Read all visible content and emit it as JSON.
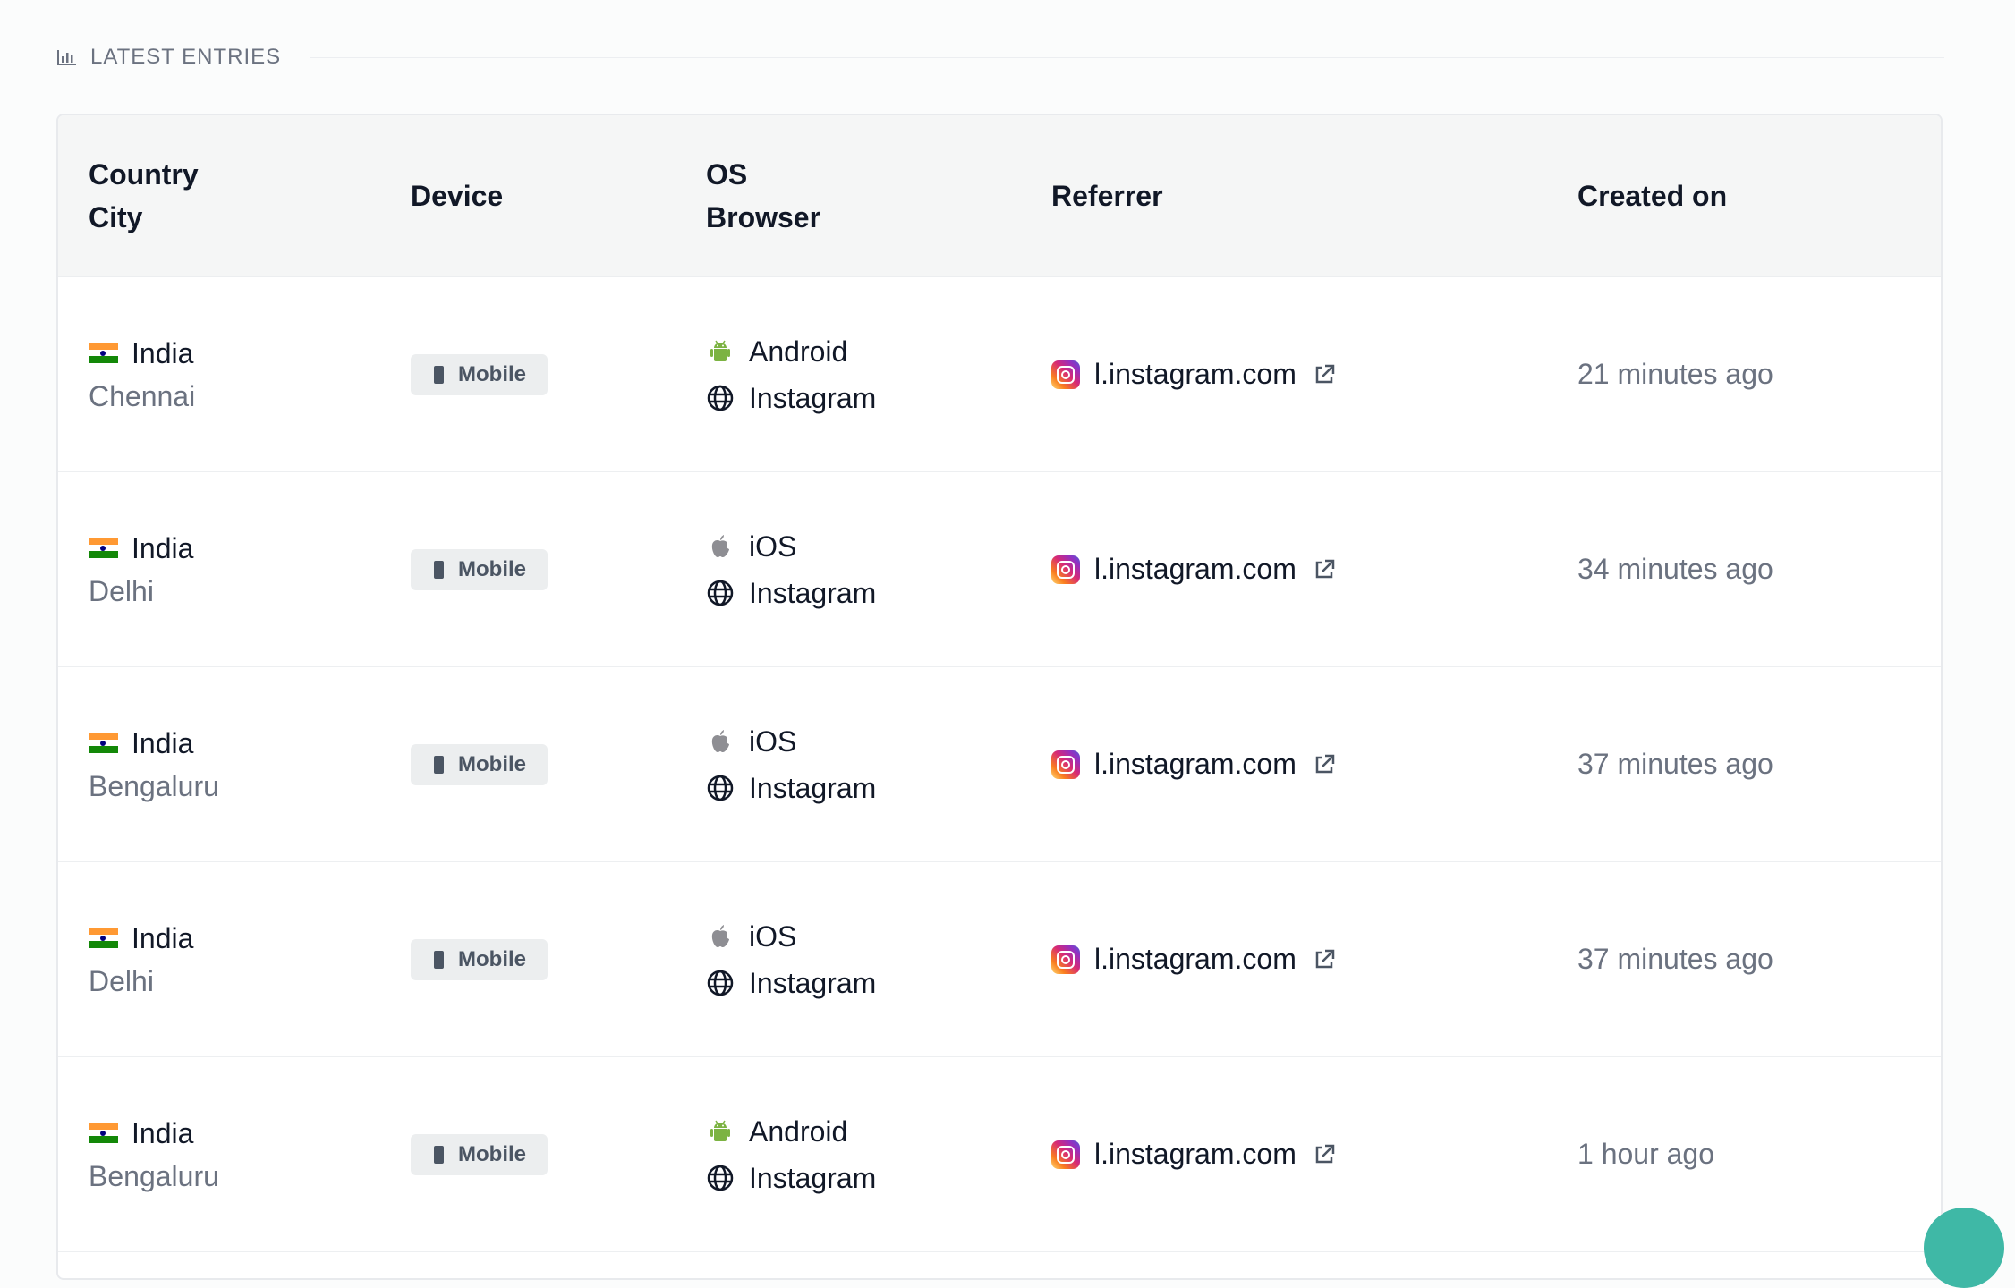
{
  "section": {
    "title": "LATEST ENTRIES",
    "icon": "bar-chart-icon"
  },
  "columns": {
    "country_city": [
      "Country",
      "City"
    ],
    "device": "Device",
    "os_browser": [
      "OS",
      "Browser"
    ],
    "referrer": "Referrer",
    "created_on": "Created on"
  },
  "rows": [
    {
      "country": "India",
      "city": "Chennai",
      "device": "Mobile",
      "os": "Android",
      "os_icon": "android-icon",
      "browser": "Instagram",
      "browser_icon": "globe-icon",
      "referrer": "l.instagram.com",
      "created": "21 minutes ago"
    },
    {
      "country": "India",
      "city": "Delhi",
      "device": "Mobile",
      "os": "iOS",
      "os_icon": "apple-icon",
      "browser": "Instagram",
      "browser_icon": "globe-icon",
      "referrer": "l.instagram.com",
      "created": "34 minutes ago"
    },
    {
      "country": "India",
      "city": "Bengaluru",
      "device": "Mobile",
      "os": "iOS",
      "os_icon": "apple-icon",
      "browser": "Instagram",
      "browser_icon": "globe-icon",
      "referrer": "l.instagram.com",
      "created": "37 minutes ago"
    },
    {
      "country": "India",
      "city": "Delhi",
      "device": "Mobile",
      "os": "iOS",
      "os_icon": "apple-icon",
      "browser": "Instagram",
      "browser_icon": "globe-icon",
      "referrer": "l.instagram.com",
      "created": "37 minutes ago"
    },
    {
      "country": "India",
      "city": "Bengaluru",
      "device": "Mobile",
      "os": "Android",
      "os_icon": "android-icon",
      "browser": "Instagram",
      "browser_icon": "globe-icon",
      "referrer": "l.instagram.com",
      "created": "1 hour ago"
    }
  ],
  "colors": {
    "android": "#7cb342",
    "apple": "#8e8e93",
    "fab": "#3fb8a6"
  }
}
